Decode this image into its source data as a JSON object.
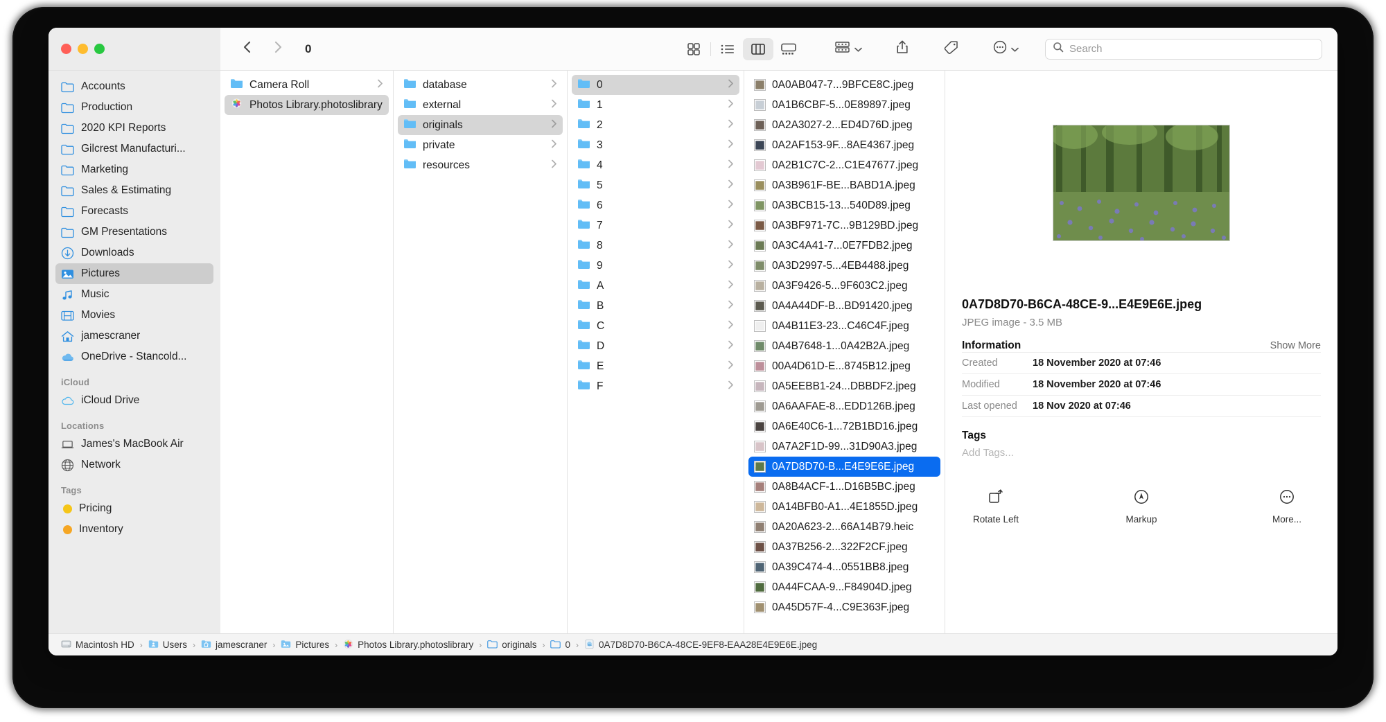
{
  "window": {
    "traffic_lights": [
      "close",
      "minimize",
      "zoom"
    ],
    "title": "0"
  },
  "toolbar": {
    "back_icon": "chevron-left-icon",
    "forward_icon": "chevron-right-icon",
    "view_icons": [
      "icon-view",
      "list-view",
      "column-view",
      "gallery-view"
    ],
    "active_view": "column-view",
    "group_icon": "group-by-icon",
    "share_icon": "share-icon",
    "tag_icon": "tag-icon",
    "more_icon": "more-actions-icon",
    "search_placeholder": "Search",
    "search_value": ""
  },
  "sidebar": {
    "favourites": [
      {
        "label": "Accounts",
        "icon": "folder-icon"
      },
      {
        "label": "Production",
        "icon": "folder-icon"
      },
      {
        "label": "2020 KPI Reports",
        "icon": "folder-icon"
      },
      {
        "label": "Gilcrest Manufacturi...",
        "icon": "folder-icon"
      },
      {
        "label": "Marketing",
        "icon": "folder-icon"
      },
      {
        "label": "Sales & Estimating",
        "icon": "folder-icon"
      },
      {
        "label": "Forecasts",
        "icon": "folder-icon"
      },
      {
        "label": "GM Presentations",
        "icon": "folder-icon"
      },
      {
        "label": "Downloads",
        "icon": "downloads-icon"
      },
      {
        "label": "Pictures",
        "icon": "pictures-icon",
        "selected": true
      },
      {
        "label": "Music",
        "icon": "music-icon"
      },
      {
        "label": "Movies",
        "icon": "movies-icon"
      },
      {
        "label": "jamescraner",
        "icon": "home-icon"
      },
      {
        "label": "OneDrive - Stancold...",
        "icon": "onedrive-cloud-icon"
      }
    ],
    "icloud_header": "iCloud",
    "icloud": [
      {
        "label": "iCloud Drive",
        "icon": "icloud-drive-icon"
      }
    ],
    "locations_header": "Locations",
    "locations": [
      {
        "label": "James's MacBook Air",
        "icon": "laptop-icon"
      },
      {
        "label": "Network",
        "icon": "globe-icon"
      }
    ],
    "tags_header": "Tags",
    "tags": [
      {
        "label": "Pricing",
        "color": "#f5c518"
      },
      {
        "label": "Inventory",
        "color": "#f5a623"
      }
    ]
  },
  "columns": {
    "col1": [
      {
        "label": "Camera Roll",
        "icon": "folder-icon",
        "disclosure": true
      },
      {
        "label": "Photos Library.photoslibrary",
        "icon": "photos-library-icon",
        "selected": true,
        "disclosure": false
      }
    ],
    "col2": [
      {
        "label": "database",
        "icon": "folder-icon",
        "disclosure": true
      },
      {
        "label": "external",
        "icon": "folder-icon",
        "disclosure": true
      },
      {
        "label": "originals",
        "icon": "folder-icon",
        "disclosure": true,
        "selected": true
      },
      {
        "label": "private",
        "icon": "folder-icon",
        "disclosure": true
      },
      {
        "label": "resources",
        "icon": "folder-icon",
        "disclosure": true
      }
    ],
    "col3": [
      {
        "label": "0",
        "icon": "folder-icon",
        "disclosure": true,
        "selected": true
      },
      {
        "label": "1",
        "icon": "folder-icon",
        "disclosure": true
      },
      {
        "label": "2",
        "icon": "folder-icon",
        "disclosure": true
      },
      {
        "label": "3",
        "icon": "folder-icon",
        "disclosure": true
      },
      {
        "label": "4",
        "icon": "folder-icon",
        "disclosure": true
      },
      {
        "label": "5",
        "icon": "folder-icon",
        "disclosure": true
      },
      {
        "label": "6",
        "icon": "folder-icon",
        "disclosure": true
      },
      {
        "label": "7",
        "icon": "folder-icon",
        "disclosure": true
      },
      {
        "label": "8",
        "icon": "folder-icon",
        "disclosure": true
      },
      {
        "label": "9",
        "icon": "folder-icon",
        "disclosure": true
      },
      {
        "label": "A",
        "icon": "folder-icon",
        "disclosure": true
      },
      {
        "label": "B",
        "icon": "folder-icon",
        "disclosure": true
      },
      {
        "label": "C",
        "icon": "folder-icon",
        "disclosure": true
      },
      {
        "label": "D",
        "icon": "folder-icon",
        "disclosure": true
      },
      {
        "label": "E",
        "icon": "folder-icon",
        "disclosure": true
      },
      {
        "label": "F",
        "icon": "folder-icon",
        "disclosure": true
      }
    ],
    "col4": [
      {
        "label": "0A0AB047-7...9BFCE8C.jpeg",
        "icon": "image-thumbnail",
        "thumb": "#8b7f6a"
      },
      {
        "label": "0A1B6CBF-5...0E89897.jpeg",
        "icon": "image-thumbnail",
        "thumb": "#c8cfd6"
      },
      {
        "label": "0A2A3027-2...ED4D76D.jpeg",
        "icon": "image-thumbnail",
        "thumb": "#6d6057"
      },
      {
        "label": "0A2AF153-9F...8AE4367.jpeg",
        "icon": "image-thumbnail",
        "thumb": "#3c4656"
      },
      {
        "label": "0A2B1C7C-2...C1E47677.jpeg",
        "icon": "image-thumbnail",
        "thumb": "#e3c9d2"
      },
      {
        "label": "0A3B961F-BE...BABD1A.jpeg",
        "icon": "image-thumbnail",
        "thumb": "#9a8f5e"
      },
      {
        "label": "0A3BCB15-13...540D89.jpeg",
        "icon": "image-thumbnail",
        "thumb": "#7f9463"
      },
      {
        "label": "0A3BF971-7C...9B129BD.jpeg",
        "icon": "image-thumbnail",
        "thumb": "#7a5a46"
      },
      {
        "label": "0A3C4A41-7...0E7FDB2.jpeg",
        "icon": "image-thumbnail",
        "thumb": "#6b7a55"
      },
      {
        "label": "0A3D2997-5...4EB4488.jpeg",
        "icon": "image-thumbnail",
        "thumb": "#7e8c6a"
      },
      {
        "label": "0A3F9426-5...9F603C2.jpeg",
        "icon": "image-thumbnail",
        "thumb": "#b8b0a0"
      },
      {
        "label": "0A4A44DF-B...BD91420.jpeg",
        "icon": "image-thumbnail",
        "thumb": "#5c5a4f"
      },
      {
        "label": "0A4B11E3-23...C46C4F.jpeg",
        "icon": "image-thumbnail",
        "thumb": "#efefef"
      },
      {
        "label": "0A4B7648-1...0A42B2A.jpeg",
        "icon": "image-thumbnail",
        "thumb": "#6f8a6a"
      },
      {
        "label": "00A4D61D-E...8745B12.jpeg",
        "icon": "image-thumbnail",
        "thumb": "#bd8f9a"
      },
      {
        "label": "0A5EEBB1-24...DBBDF2.jpeg",
        "icon": "image-thumbnail",
        "thumb": "#c7b6bd"
      },
      {
        "label": "0A6AAFAE-8...EDD126B.jpeg",
        "icon": "image-thumbnail",
        "thumb": "#9e9a92"
      },
      {
        "label": "0A6E40C6-1...72B1BD16.jpeg",
        "icon": "image-thumbnail",
        "thumb": "#4a4340"
      },
      {
        "label": "0A7A2F1D-99...31D90A3.jpeg",
        "icon": "image-thumbnail",
        "thumb": "#d8c4c8"
      },
      {
        "label": "0A7D8D70-B...E4E9E6E.jpeg",
        "icon": "image-thumbnail",
        "thumb": "#5f7a4a",
        "selected": true
      },
      {
        "label": "0A8B4ACF-1...D16B5BC.jpeg",
        "icon": "image-thumbnail",
        "thumb": "#a57f7a"
      },
      {
        "label": "0A14BFB0-A1...4E1855D.jpeg",
        "icon": "image-thumbnail",
        "thumb": "#cdb79a"
      },
      {
        "label": "0A20A623-2...66A14B79.heic",
        "icon": "image-thumbnail",
        "thumb": "#8f7f72"
      },
      {
        "label": "0A37B256-2...322F2CF.jpeg",
        "icon": "image-thumbnail",
        "thumb": "#6d5146"
      },
      {
        "label": "0A39C474-4...0551BB8.jpeg",
        "icon": "image-thumbnail",
        "thumb": "#4f6474"
      },
      {
        "label": "0A44FCAA-9...F84904D.jpeg",
        "icon": "image-thumbnail",
        "thumb": "#4f6b3f"
      },
      {
        "label": "0A45D57F-4...C9E363F.jpeg",
        "icon": "image-thumbnail",
        "thumb": "#a09070"
      }
    ]
  },
  "preview": {
    "filename": "0A7D8D70-B6CA-48CE-9...E4E9E6E.jpeg",
    "kind": "JPEG image - 3.5 MB",
    "information_title": "Information",
    "show_more": "Show More",
    "info_rows": [
      {
        "key": "Created",
        "value": "18 November 2020 at 07:46"
      },
      {
        "key": "Modified",
        "value": "18 November 2020 at 07:46"
      },
      {
        "key": "Last opened",
        "value": "18 Nov 2020 at 07:46"
      }
    ],
    "tags_title": "Tags",
    "tags_placeholder": "Add Tags...",
    "actions": [
      {
        "label": "Rotate Left",
        "icon": "rotate-left-icon"
      },
      {
        "label": "Markup",
        "icon": "markup-icon"
      },
      {
        "label": "More...",
        "icon": "more-icon"
      }
    ]
  },
  "pathbar": [
    {
      "label": "Macintosh HD",
      "icon": "hard-drive-icon"
    },
    {
      "label": "Users",
      "icon": "users-folder-icon"
    },
    {
      "label": "jamescraner",
      "icon": "home-folder-icon"
    },
    {
      "label": "Pictures",
      "icon": "pictures-folder-icon"
    },
    {
      "label": "Photos Library.photoslibrary",
      "icon": "photos-library-icon"
    },
    {
      "label": "originals",
      "icon": "folder-icon"
    },
    {
      "label": "0",
      "icon": "folder-icon"
    },
    {
      "label": "0A7D8D70-B6CA-48CE-9EF8-EAA28E4E9E6E.jpeg",
      "icon": "jpeg-file-icon"
    }
  ],
  "colors": {
    "accent": "#0a6cf0",
    "folder_blue": "#5ab4f0",
    "sidebar_bg": "#ececec",
    "selection_grey": "#d6d6d6"
  }
}
